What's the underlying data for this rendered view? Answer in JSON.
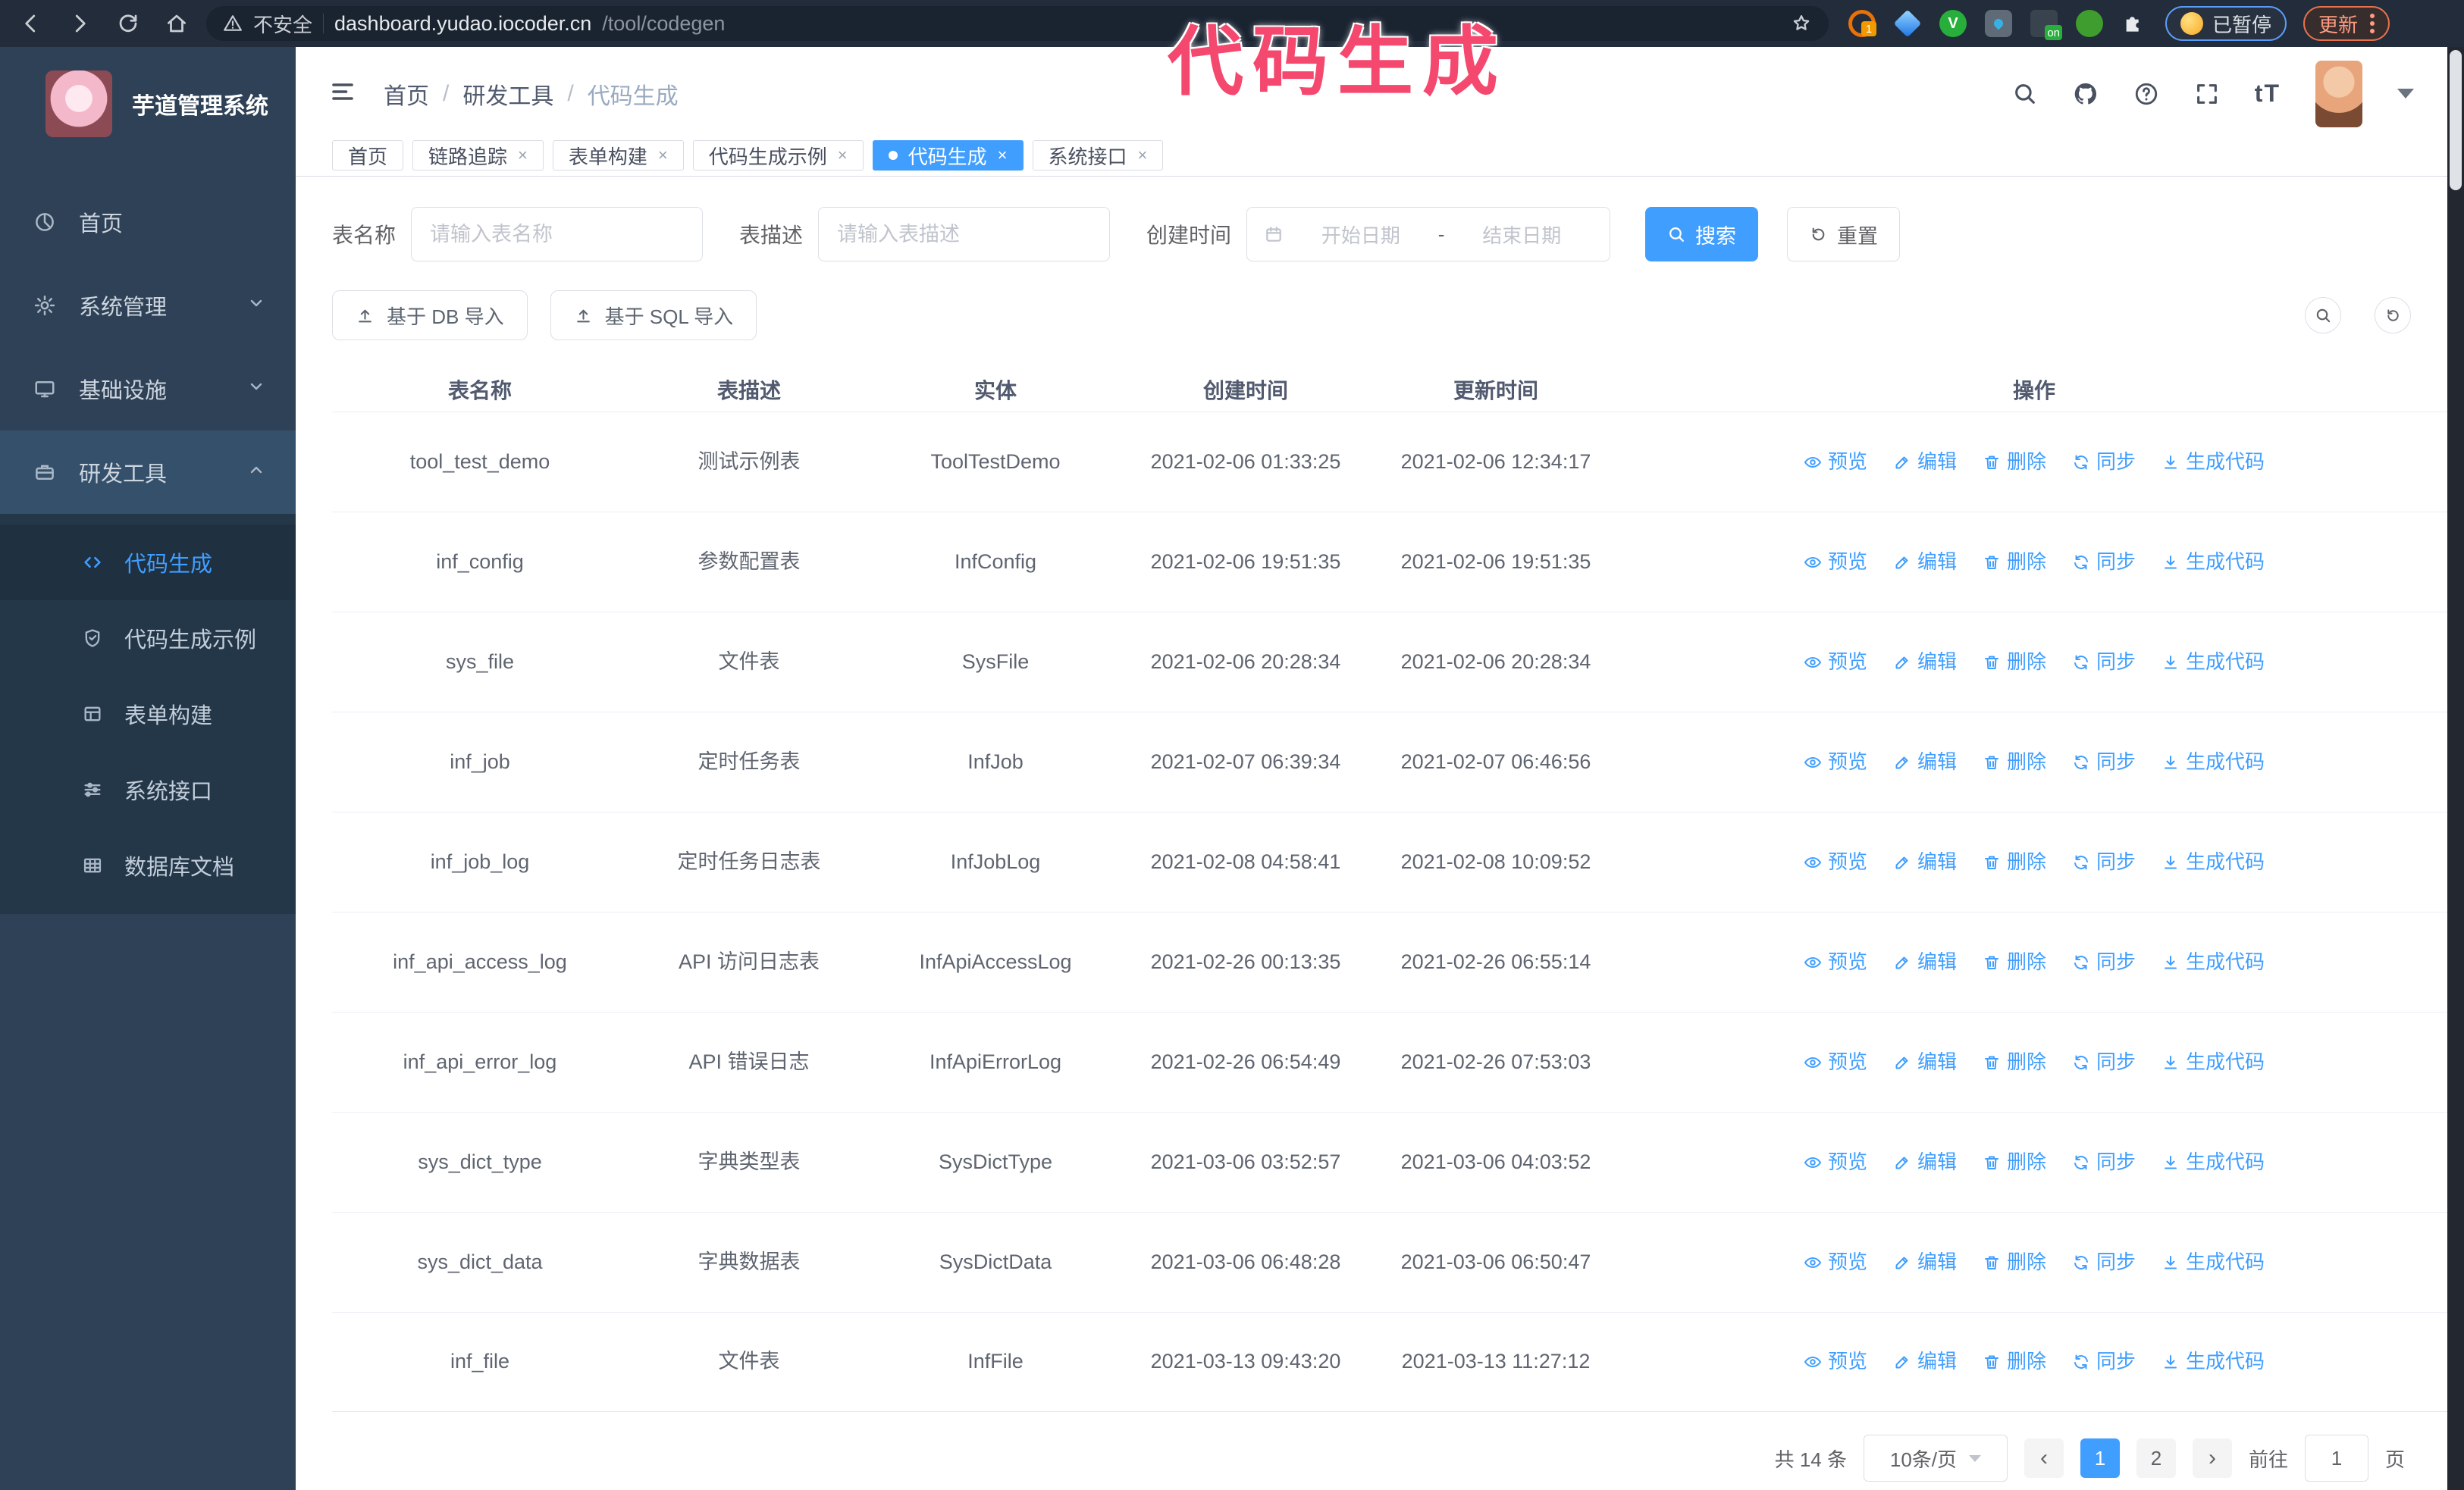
{
  "annotation": {
    "text": "代码生成",
    "color": "#f5486f"
  },
  "browser": {
    "security_label": "不安全",
    "url_host": "dashboard.yudao.iocoder.cn",
    "url_path": "/tool/codegen",
    "ext_badge_count": "1",
    "ext_badge_on": "on",
    "paused_label": "已暂停",
    "update_label": "更新"
  },
  "sidebar": {
    "title": "芋道管理系统",
    "items": [
      {
        "label": "首页"
      },
      {
        "label": "系统管理"
      },
      {
        "label": "基础设施"
      },
      {
        "label": "研发工具"
      }
    ],
    "subitems": [
      {
        "label": "代码生成"
      },
      {
        "label": "代码生成示例"
      },
      {
        "label": "表单构建"
      },
      {
        "label": "系统接口"
      },
      {
        "label": "数据库文档"
      }
    ]
  },
  "header": {
    "breadcrumb": [
      "首页",
      "研发工具",
      "代码生成"
    ],
    "font_size_icon": "tT"
  },
  "tabs": [
    {
      "label": "首页"
    },
    {
      "label": "链路追踪"
    },
    {
      "label": "表单构建"
    },
    {
      "label": "代码生成示例"
    },
    {
      "label": "代码生成"
    },
    {
      "label": "系统接口"
    }
  ],
  "filters": {
    "table_name_label": "表名称",
    "table_name_placeholder": "请输入表名称",
    "table_desc_label": "表描述",
    "table_desc_placeholder": "请输入表描述",
    "create_time_label": "创建时间",
    "date_start_placeholder": "开始日期",
    "date_separator": "-",
    "date_end_placeholder": "结束日期",
    "search_label": "搜索",
    "reset_label": "重置"
  },
  "toolbar": {
    "import_db_label": "基于 DB 导入",
    "import_sql_label": "基于 SQL 导入"
  },
  "table": {
    "columns": [
      "表名称",
      "表描述",
      "实体",
      "创建时间",
      "更新时间",
      "操作"
    ],
    "actions": [
      "预览",
      "编辑",
      "删除",
      "同步",
      "生成代码"
    ],
    "rows": [
      {
        "name": "tool_test_demo",
        "desc": "测试示例表",
        "entity": "ToolTestDemo",
        "created": "2021-02-06 01:33:25",
        "updated": "2021-02-06 12:34:17"
      },
      {
        "name": "inf_config",
        "desc": "参数配置表",
        "entity": "InfConfig",
        "created": "2021-02-06 19:51:35",
        "updated": "2021-02-06 19:51:35"
      },
      {
        "name": "sys_file",
        "desc": "文件表",
        "entity": "SysFile",
        "created": "2021-02-06 20:28:34",
        "updated": "2021-02-06 20:28:34"
      },
      {
        "name": "inf_job",
        "desc": "定时任务表",
        "entity": "InfJob",
        "created": "2021-02-07 06:39:34",
        "updated": "2021-02-07 06:46:56"
      },
      {
        "name": "inf_job_log",
        "desc": "定时任务日志表",
        "entity": "InfJobLog",
        "created": "2021-02-08 04:58:41",
        "updated": "2021-02-08 10:09:52"
      },
      {
        "name": "inf_api_access_log",
        "desc": "API 访问日志表",
        "entity": "InfApiAccessLog",
        "created": "2021-02-26 00:13:35",
        "updated": "2021-02-26 06:55:14"
      },
      {
        "name": "inf_api_error_log",
        "desc": "API 错误日志",
        "entity": "InfApiErrorLog",
        "created": "2021-02-26 06:54:49",
        "updated": "2021-02-26 07:53:03"
      },
      {
        "name": "sys_dict_type",
        "desc": "字典类型表",
        "entity": "SysDictType",
        "created": "2021-03-06 03:52:57",
        "updated": "2021-03-06 04:03:52"
      },
      {
        "name": "sys_dict_data",
        "desc": "字典数据表",
        "entity": "SysDictData",
        "created": "2021-03-06 06:48:28",
        "updated": "2021-03-06 06:50:47"
      },
      {
        "name": "inf_file",
        "desc": "文件表",
        "entity": "InfFile",
        "created": "2021-03-13 09:43:20",
        "updated": "2021-03-13 11:27:12"
      }
    ]
  },
  "pagination": {
    "total": "共 14 条",
    "page_size": "10条/页",
    "pages": [
      "1",
      "2"
    ],
    "active_page": "1",
    "goto_label": "前往",
    "goto_value": "1",
    "page_unit": "页"
  },
  "colors": {
    "accent": "#409eff",
    "sidebar_bg": "#2f4156",
    "submenu_bg": "#233749",
    "annotation": "#f5486f"
  }
}
